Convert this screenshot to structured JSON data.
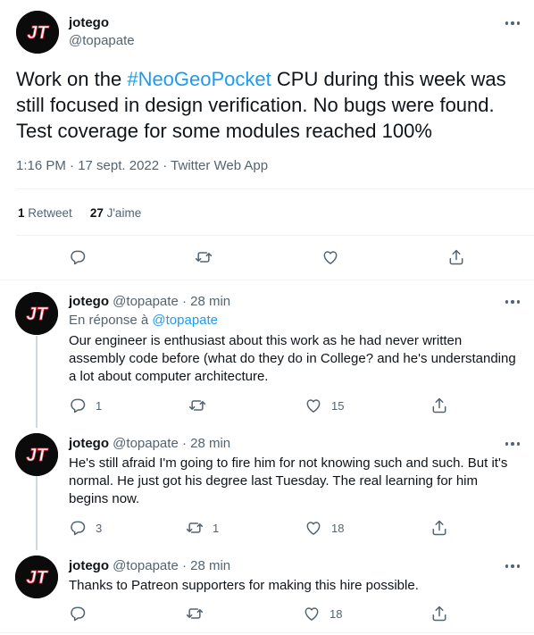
{
  "main_tweet": {
    "author": {
      "name": "jotego",
      "handle": "@topapate",
      "avatar_text": "JT"
    },
    "text_before": "Work on the ",
    "hashtag": "#NeoGeoPocket",
    "text_after": " CPU during this week was still focused in design verification. No bugs were found. Test coverage for some modules reached 100%",
    "meta": "1:16 PM · 17 sept. 2022 · Twitter Web App",
    "stats": {
      "retweets_count": "1",
      "retweets_label": "Retweet",
      "likes_count": "27",
      "likes_label": "J'aime"
    },
    "actions": [
      "reply-icon",
      "retweet-icon",
      "like-icon",
      "share-icon"
    ]
  },
  "replies": [
    {
      "name": "jotego",
      "handle": "@topapate · 28 min",
      "reply_prefix": "En réponse à ",
      "reply_to": "@topapate",
      "text": "Our engineer is enthusiast about this work as he had never written assembly code before (what do they do in College? and he's understanding a lot about computer architecture.",
      "replies": "1",
      "retweets": "",
      "likes": "15"
    },
    {
      "name": "jotego",
      "handle": "@topapate · 28 min",
      "text": "He's still afraid I'm going to fire him for not knowing such and such. But it's normal. He just got his degree last Tuesday. The real learning for him begins now.",
      "replies": "3",
      "retweets": "1",
      "likes": "18"
    },
    {
      "name": "jotego",
      "handle": "@topapate · 28 min",
      "text": "Thanks to Patreon supporters for making this hire possible.",
      "replies": "",
      "retweets": "",
      "likes": "18"
    }
  ],
  "colors": {
    "accent": "#1d9bf0",
    "secondary_text": "#536471",
    "primary_text": "#0f1419",
    "divider": "#eff3f4"
  }
}
